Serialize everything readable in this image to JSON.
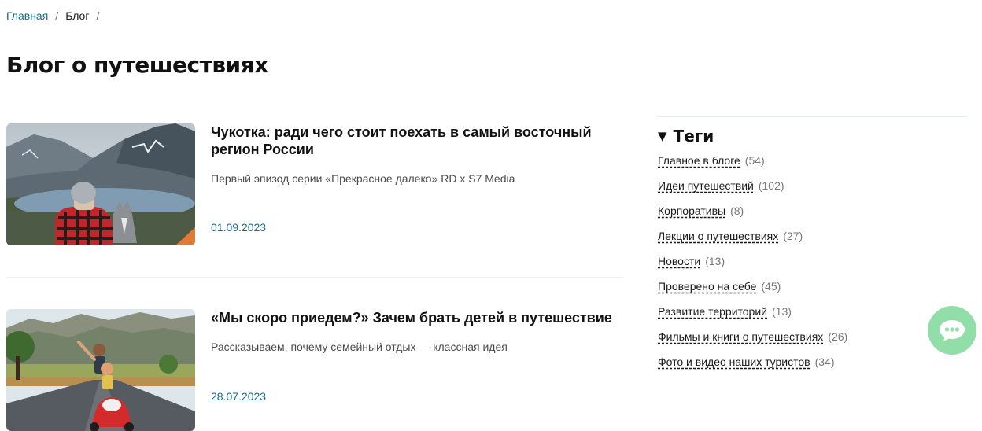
{
  "breadcrumb": {
    "home": "Главная",
    "separator": "/",
    "current": "Блог",
    "trailing_separator": "/"
  },
  "page_title": "Блог о путешествиях",
  "posts": [
    {
      "title": "Чукотка: ради чего стоит поехать в самый восточный регион России",
      "description": "Первый эпизод серии «Прекрасное далеко» RD x S7 Media",
      "date": "01.09.2023"
    },
    {
      "title": "«Мы скоро приедем?» Зачем брать детей в путешествие",
      "description": "Рассказываем, почему семейный отдых — классная идея",
      "date": "28.07.2023"
    }
  ],
  "tags": {
    "heading": "Теги",
    "items": [
      {
        "label": "Главное в блоге",
        "count": "(54)"
      },
      {
        "label": "Идеи путешествий",
        "count": "(102)"
      },
      {
        "label": "Корпоративы",
        "count": "(8)"
      },
      {
        "label": "Лекции о путешествиях",
        "count": "(27)"
      },
      {
        "label": "Новости",
        "count": "(13)"
      },
      {
        "label": "Проверено на себе",
        "count": "(45)"
      },
      {
        "label": "Развитие территорий",
        "count": "(13)"
      },
      {
        "label": "Фильмы и книги о путешествиях",
        "count": "(26)"
      },
      {
        "label": "Фото и видео наших туристов",
        "count": "(34)"
      }
    ]
  },
  "colors": {
    "accent_link": "#1c6b8a",
    "chat_button": "#7ed99a"
  },
  "icons": {
    "chat": "chat-bubble-icon"
  }
}
